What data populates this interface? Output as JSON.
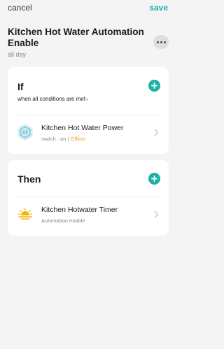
{
  "topbar": {
    "cancel_label": "cancel",
    "save_label": "save"
  },
  "header": {
    "title": "Kitchen Hot Water Automation Enable",
    "subtitle": "all day"
  },
  "if_section": {
    "heading": "If",
    "condition_mode": "when all conditions are met",
    "conditions": [
      {
        "name": "Kitchen Hot Water Power",
        "detail": "switch : on | ",
        "status": "Offline",
        "icon": "device-icon"
      }
    ]
  },
  "then_section": {
    "heading": "Then",
    "actions": [
      {
        "name": "Kitchen Hotwater Timer",
        "detail": "Automation:enable",
        "icon": "sunrise-icon"
      }
    ]
  },
  "colors": {
    "accent": "#1bb1a3",
    "offline": "#f0a020",
    "sun": "#f4b400"
  }
}
